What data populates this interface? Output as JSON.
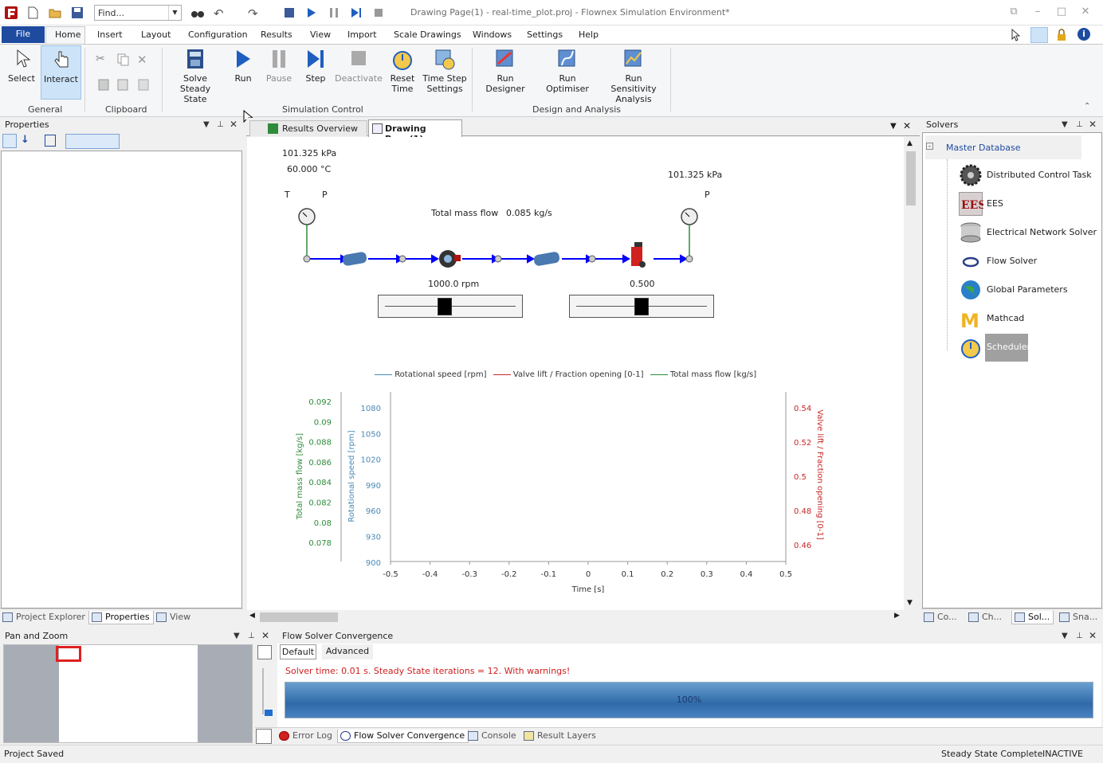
{
  "window": {
    "title": "Drawing Page(1) - real-time_plot.proj - Flownex Simulation Environment*",
    "find_placeholder": "Find..."
  },
  "menu": {
    "file": "File",
    "items": [
      "Home",
      "Insert",
      "Layout",
      "Configuration",
      "Results",
      "View",
      "Import",
      "Scale Drawings",
      "Windows",
      "Settings",
      "Help"
    ]
  },
  "ribbon": {
    "select": "Select",
    "interact": "Interact",
    "general": "General",
    "clipboard": "Clipboard",
    "solve_steady_1": "Solve Steady",
    "solve_steady_2": "State",
    "run": "Run",
    "pause": "Pause",
    "step": "Step",
    "deactivate": "Deactivate",
    "reset_1": "Reset",
    "reset_2": "Time",
    "timestep_1": "Time Step",
    "timestep_2": "Settings",
    "simulation_control": "Simulation Control",
    "run_designer": "Run Designer",
    "run_optimiser": "Run Optimiser",
    "run_sens_1": "Run Sensitivity",
    "run_sens_2": "Analysis",
    "design_analysis": "Design and Analysis"
  },
  "properties": {
    "title": "Properties",
    "tabs": [
      "Project Explorer",
      "Properties",
      "View"
    ]
  },
  "doc_tabs": {
    "results_overview": "Results Overview",
    "drawing_page": "Drawing Page(1)"
  },
  "diagram": {
    "inlet_pressure": "101.325 kPa",
    "inlet_temperature": "60.000 °C",
    "outlet_pressure": "101.325 kPa",
    "t_label": "T",
    "p_label_in": "P",
    "p_label_out": "P",
    "mass_flow_label": "Total mass flow",
    "mass_flow_value": "0.085 kg/s",
    "pump_speed": "1000.0 rpm",
    "valve_value": "0.500",
    "pump_slider_fraction": 0.45,
    "valve_slider_fraction": 0.5
  },
  "chart_data": {
    "type": "line",
    "title": "",
    "xlabel": "Time [s]",
    "xlim": [
      -0.5,
      0.5
    ],
    "x_ticks": [
      "-0.5",
      "-0.4",
      "-0.3",
      "-0.2",
      "-0.1",
      "0",
      "0.1",
      "0.2",
      "0.3",
      "0.4",
      "0.5"
    ],
    "legend_position": "top",
    "series": [
      {
        "name": "Rotational speed [rpm]",
        "color": "#4a8ab6",
        "values": []
      },
      {
        "name": "Valve lift / Fraction opening [0-1]",
        "color": "#c62828",
        "values": []
      },
      {
        "name": "Total mass flow [kg/s]",
        "color": "#2e8b3a",
        "values": []
      }
    ],
    "axes": {
      "mass_flow": {
        "label": "Total mass flow [kg/s]",
        "color": "#2e8b3a",
        "ticks": [
          "0.092",
          "0.09",
          "0.088",
          "0.086",
          "0.084",
          "0.082",
          "0.08",
          "0.078"
        ]
      },
      "speed": {
        "label": "Rotational speed [rpm]",
        "color": "#4a8ab6",
        "ylim": [
          900,
          1080
        ],
        "ticks": [
          "1080",
          "1050",
          "1020",
          "990",
          "960",
          "930",
          "900"
        ]
      },
      "valve": {
        "label": "Valve lift / Fraction opening [0-1]",
        "color": "#c62828",
        "ticks": [
          "0.54",
          "0.52",
          "0.5",
          "0.48",
          "0.46"
        ]
      }
    }
  },
  "solvers": {
    "title": "Solvers",
    "root": "Master Database",
    "items": [
      "Distributed Control Task",
      "EES",
      "Electrical Network Solver",
      "Flow Solver",
      "Global Parameters",
      "Mathcad",
      "Scheduler"
    ],
    "tabs": [
      "Co...",
      "Ch...",
      "Sol...",
      "Sna..."
    ]
  },
  "pan_zoom": {
    "title": "Pan and Zoom"
  },
  "convergence": {
    "title": "Flow Solver Convergence",
    "tab_default": "Default",
    "tab_advanced": "Advanced",
    "message": "Solver time: 0.01 s. Steady State iterations = 12. With warnings!",
    "progress": "100%",
    "progress_fraction": 1.0,
    "bottom_tabs": [
      "Error Log",
      "Flow Solver Convergence",
      "Console",
      "Result Layers"
    ]
  },
  "status": {
    "left": "Project Saved",
    "state": "Steady State Complete",
    "mode": "INACTIVE"
  },
  "colors": {
    "accent": "#1e4ba0",
    "flow_line": "#0000ff",
    "progress": "#3d7ab8",
    "error_text": "#d02020"
  }
}
